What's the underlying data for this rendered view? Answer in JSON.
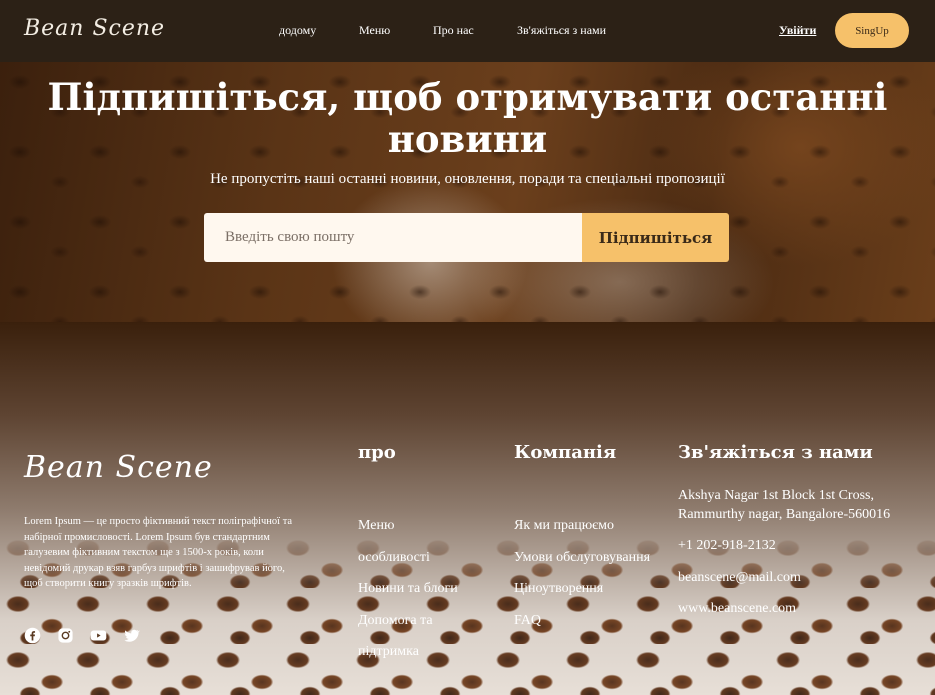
{
  "header": {
    "logo": "Bean Scene",
    "nav": [
      "додому",
      "Меню",
      "Про нас",
      "Зв'яжіться з нами"
    ],
    "login": "Увійти",
    "signup": "SingUp"
  },
  "subscribe": {
    "title": "Підпишіться, щоб отримувати останні новини",
    "subtitle": "Не пропустіть наші останні новини, оновлення, поради та спеціальні пропозиції",
    "email_placeholder": "Введіть свою пошту",
    "button": "Підпишіться"
  },
  "footer": {
    "logo": "Bean Scene",
    "description": "Lorem Ipsum — це просто фіктивний текст поліграфічної та набірної промисловості. Lorem Ipsum був стандартним галузевим фіктивним текстом ще з 1500-х років, коли невідомий друкар взяв гарбуз шрифтів і зашифрував його, щоб створити книгу зразків шрифтів.",
    "socials": [
      "facebook-icon",
      "instagram-icon",
      "youtube-icon",
      "twitter-icon"
    ],
    "about": {
      "title": "про",
      "items": [
        "Меню",
        "особливості",
        "Новини та блоги",
        "Допомога та підтримка"
      ]
    },
    "company": {
      "title": "Компанія",
      "items": [
        "Як ми працюємо",
        "Умови обслуговування",
        "Ціноутворення",
        "FAQ"
      ]
    },
    "contact": {
      "title": "Зв'яжіться з нами",
      "address": "Akshya Nagar 1st Block 1st Cross, Rammurthy nagar, Bangalore-560016",
      "phone": "+1 202-918-2132",
      "email": "beanscene@mail.com",
      "website": "www.beanscene.com"
    }
  },
  "colors": {
    "accent": "#f6c16a",
    "header_bg": "#2c2116"
  }
}
